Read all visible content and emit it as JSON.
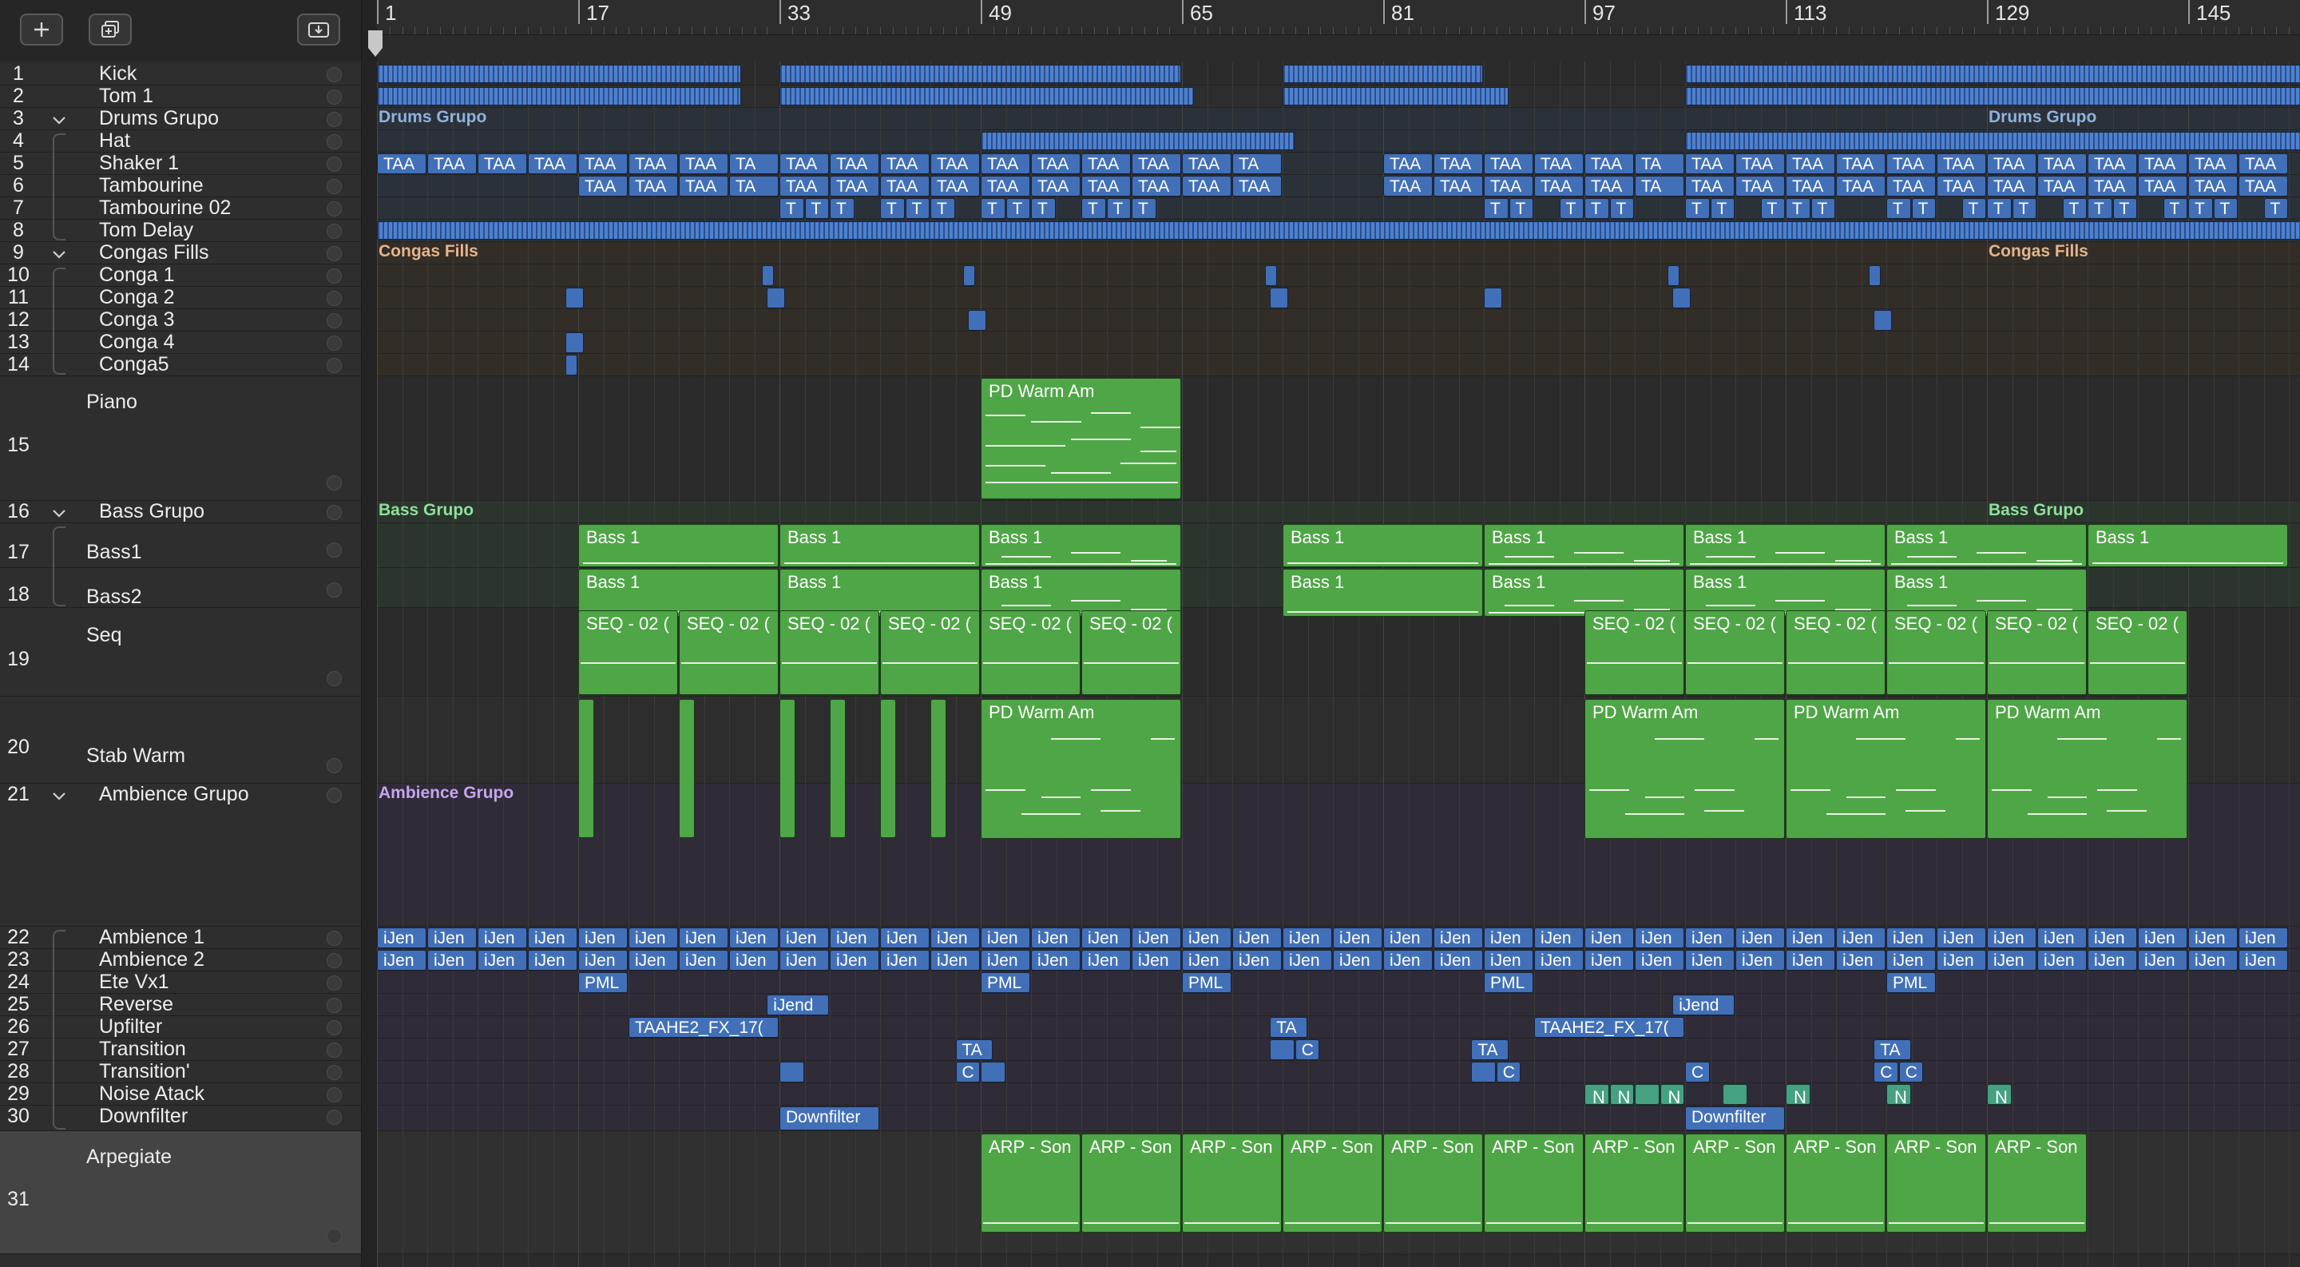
{
  "toolbar": {
    "add_icon": "plus-icon",
    "duplicate_icon": "duplicate-icon",
    "download_icon": "download-tray-icon"
  },
  "ruler": {
    "labels": [
      "1",
      "17",
      "33",
      "49",
      "65",
      "81",
      "97",
      "113",
      "129",
      "145"
    ]
  },
  "tracks": [
    {
      "num": "1",
      "name": "Kick"
    },
    {
      "num": "2",
      "name": "Tom 1"
    },
    {
      "num": "3",
      "name": "Drums Grupo"
    },
    {
      "num": "4",
      "name": "Hat"
    },
    {
      "num": "5",
      "name": "Shaker 1"
    },
    {
      "num": "6",
      "name": "Tambourine"
    },
    {
      "num": "7",
      "name": "Tambourine 02"
    },
    {
      "num": "8",
      "name": "Tom Delay"
    },
    {
      "num": "9",
      "name": "Congas Fills"
    },
    {
      "num": "10",
      "name": "Conga 1"
    },
    {
      "num": "11",
      "name": "Conga 2"
    },
    {
      "num": "12",
      "name": "Conga 3"
    },
    {
      "num": "13",
      "name": "Conga 4"
    },
    {
      "num": "14",
      "name": "Conga5"
    },
    {
      "num": "15",
      "name": "Piano"
    },
    {
      "num": "16",
      "name": "Bass Grupo"
    },
    {
      "num": "17",
      "name": "Bass1"
    },
    {
      "num": "18",
      "name": "Bass2"
    },
    {
      "num": "19",
      "name": "Seq"
    },
    {
      "num": "20",
      "name": "Stab Warm"
    },
    {
      "num": "21",
      "name": "Ambience Grupo"
    },
    {
      "num": "22",
      "name": "Ambience 1"
    },
    {
      "num": "23",
      "name": "Ambience 2"
    },
    {
      "num": "24",
      "name": "Ete Vx1"
    },
    {
      "num": "25",
      "name": "Reverse"
    },
    {
      "num": "26",
      "name": "Upfilter"
    },
    {
      "num": "27",
      "name": "Transition"
    },
    {
      "num": "28",
      "name": "Transition'"
    },
    {
      "num": "29",
      "name": "Noise Atack"
    },
    {
      "num": "30",
      "name": "Downfilter"
    },
    {
      "num": "31",
      "name": "Arpegiate"
    }
  ],
  "group_tags": {
    "drums": "Drums Grupo",
    "congas": "Congas Fills",
    "bass": "Bass Grupo",
    "ambience": "Ambience Grupo"
  },
  "region_names": {
    "taa": "TAA",
    "ta": "TA",
    "t": "T",
    "piano": "PD Warm Am",
    "bass": "Bass 1",
    "seq": "SEQ - 02 (",
    "stab": "PD Warm Am",
    "ijen": "iJen",
    "pml": "PML",
    "ijend": "iJend",
    "upfilter": "TAAHE2_FX_17(",
    "transition": "TA",
    "transition2": "C",
    "noise": "N",
    "downfilter": "Downfilter",
    "arp": "ARP - Son"
  },
  "colors": {
    "audio": "#4270b8",
    "midi": "#4fa646",
    "noise": "#44a182"
  }
}
